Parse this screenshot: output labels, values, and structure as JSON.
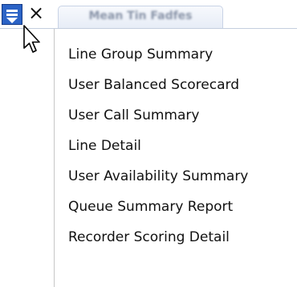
{
  "toolbar": {
    "menu_icon": "dropdown-menu-icon",
    "close_icon": "close-icon",
    "close_glyph": "×",
    "tab_label": "Mean Tin Fadfes"
  },
  "menu": {
    "items": [
      {
        "label": "Line Group Summary"
      },
      {
        "label": "User Balanced Scorecard"
      },
      {
        "label": "User Call Summary"
      },
      {
        "label": "Line Detail"
      },
      {
        "label": "User Availability Summary"
      },
      {
        "label": "Queue Summary Report"
      },
      {
        "label": "Recorder Scoring Detail"
      }
    ]
  },
  "colors": {
    "menu_button": "#2b63c6",
    "text": "#111111",
    "separator": "#c6c6c6"
  }
}
